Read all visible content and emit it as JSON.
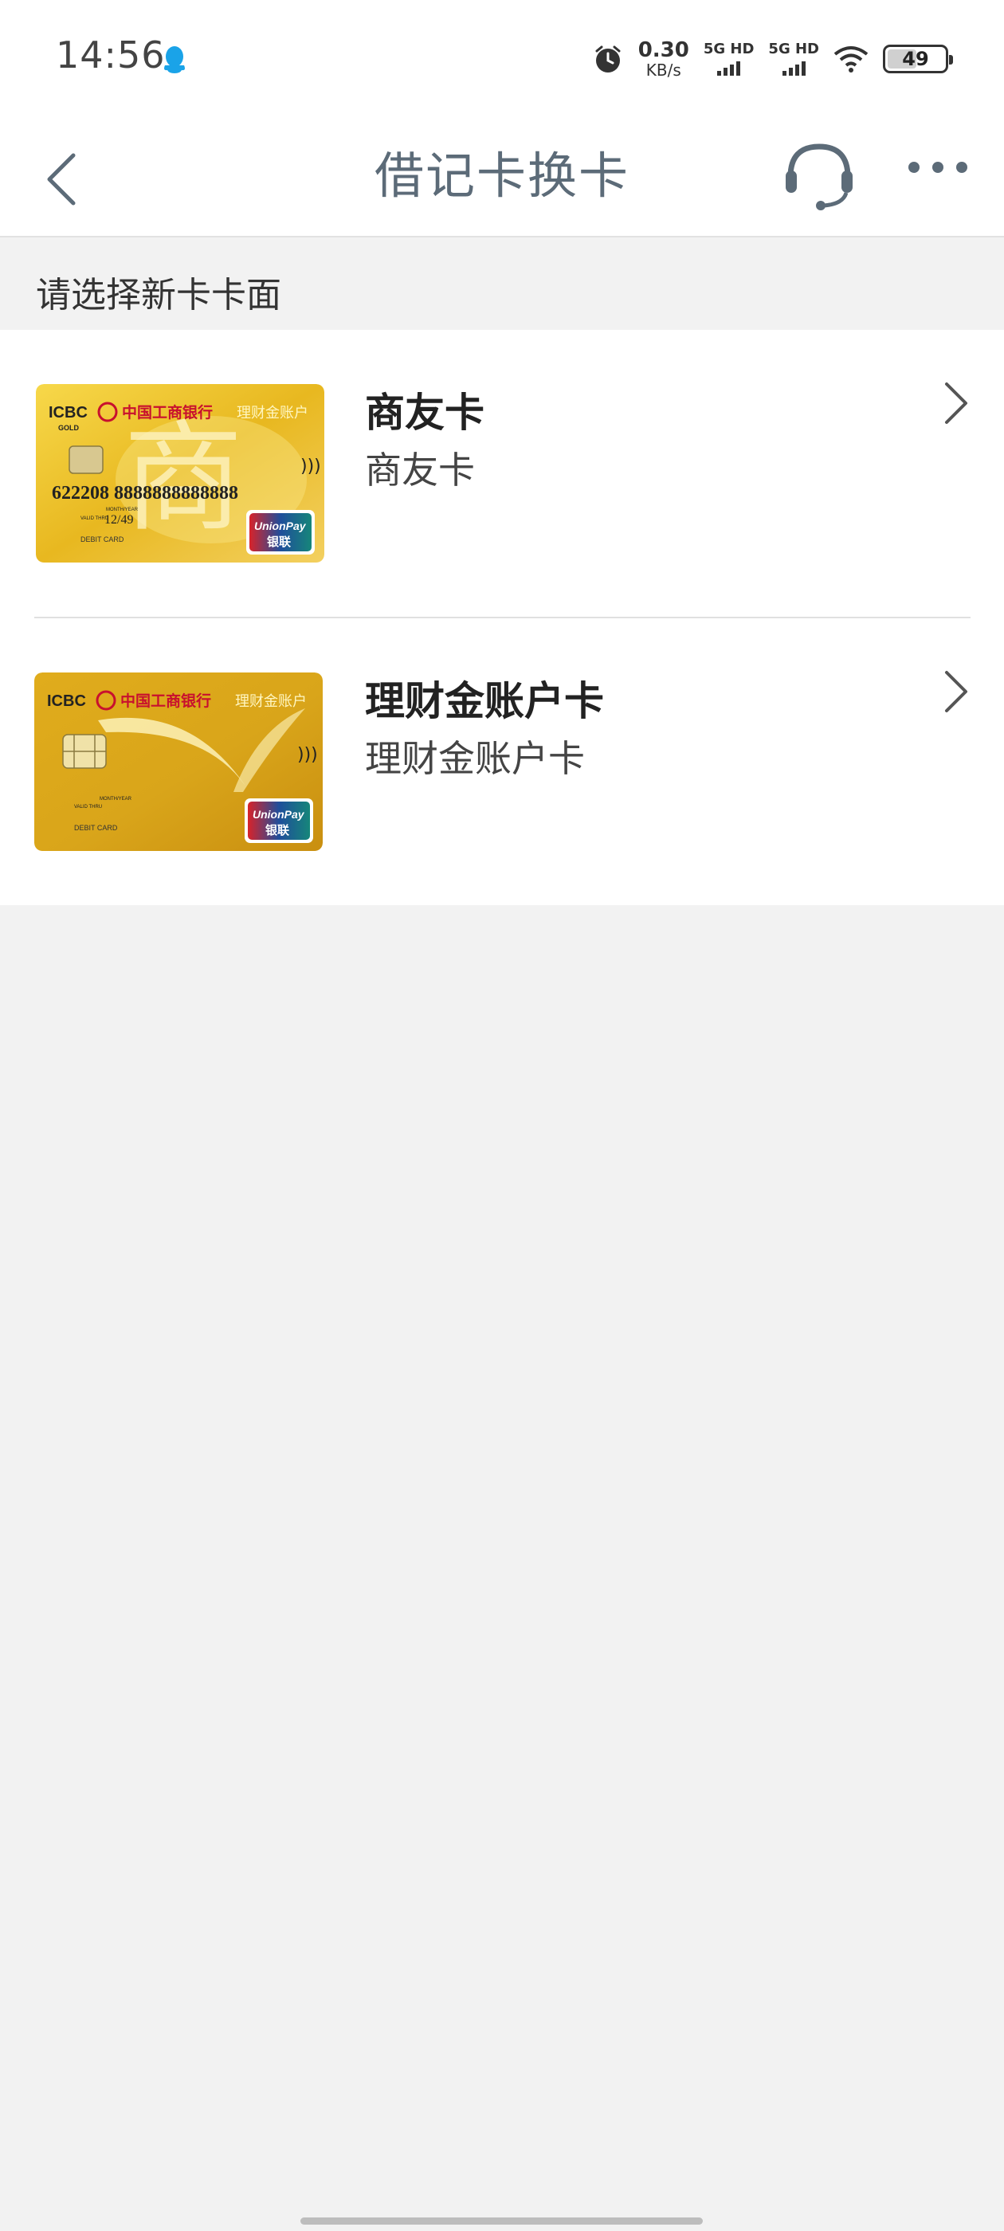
{
  "status_bar": {
    "time": "14:56",
    "net_speed_value": "0.30",
    "net_speed_unit": "KB/s",
    "sim1_label": "5G HD",
    "sim2_label": "5G HD",
    "battery": "49"
  },
  "nav": {
    "title": "借记卡换卡",
    "icons": [
      "back-icon",
      "headset-icon",
      "more-icon"
    ]
  },
  "section": {
    "label": "请选择新卡卡面"
  },
  "cards": [
    {
      "title": "商友卡",
      "subtitle": "商友卡",
      "image": {
        "bank_en": "ICBC",
        "bank_cn": "中国工商银行",
        "account_type": "理财金账户",
        "gold": "GOLD",
        "card_number": "622208 8888888888888",
        "valid_label": "VALID THRU",
        "month_year_label": "MONTH/YEAR",
        "expiry": "12/49",
        "debit_label": "DEBIT CARD",
        "unionpay_en": "UnionPay",
        "unionpay_cn": "银联",
        "emblem_char": "商"
      }
    },
    {
      "title": "理财金账户卡",
      "subtitle": "理财金账户卡",
      "image": {
        "bank_en": "ICBC",
        "bank_cn": "中国工商银行",
        "account_type": "理财金账户",
        "valid_label": "VALID THRU",
        "month_year_label": "MONTH/YEAR",
        "debit_label": "DEBIT CARD",
        "unionpay_en": "UnionPay",
        "unionpay_cn": "银联"
      }
    }
  ],
  "colors": {
    "nav_text": "#5c6b78",
    "page_bg": "#f2f2f2",
    "card_gold": "#d9a820",
    "icbc_red": "#c8102e"
  }
}
